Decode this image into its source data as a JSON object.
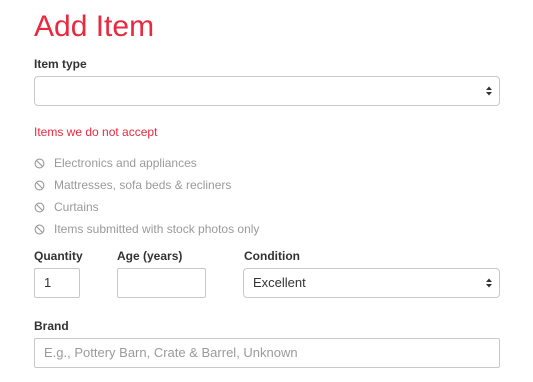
{
  "title": "Add Item",
  "item_type": {
    "label": "Item type",
    "value": ""
  },
  "not_accepted": {
    "title": "Items we do not accept",
    "icon": "ban-icon",
    "items": [
      "Electronics and appliances",
      "Mattresses, sofa beds & recliners",
      "Curtains",
      "Items submitted with stock photos only"
    ]
  },
  "quantity": {
    "label": "Quantity",
    "value": "1"
  },
  "age": {
    "label": "Age (years)",
    "value": ""
  },
  "condition": {
    "label": "Condition",
    "value": "Excellent"
  },
  "brand": {
    "label": "Brand",
    "placeholder": "E.g., Pottery Barn, Crate & Barrel, Unknown"
  },
  "colors": {
    "accent": "#e8293f",
    "border": "#c9c9c9",
    "muted_text": "#9a9a9a"
  }
}
